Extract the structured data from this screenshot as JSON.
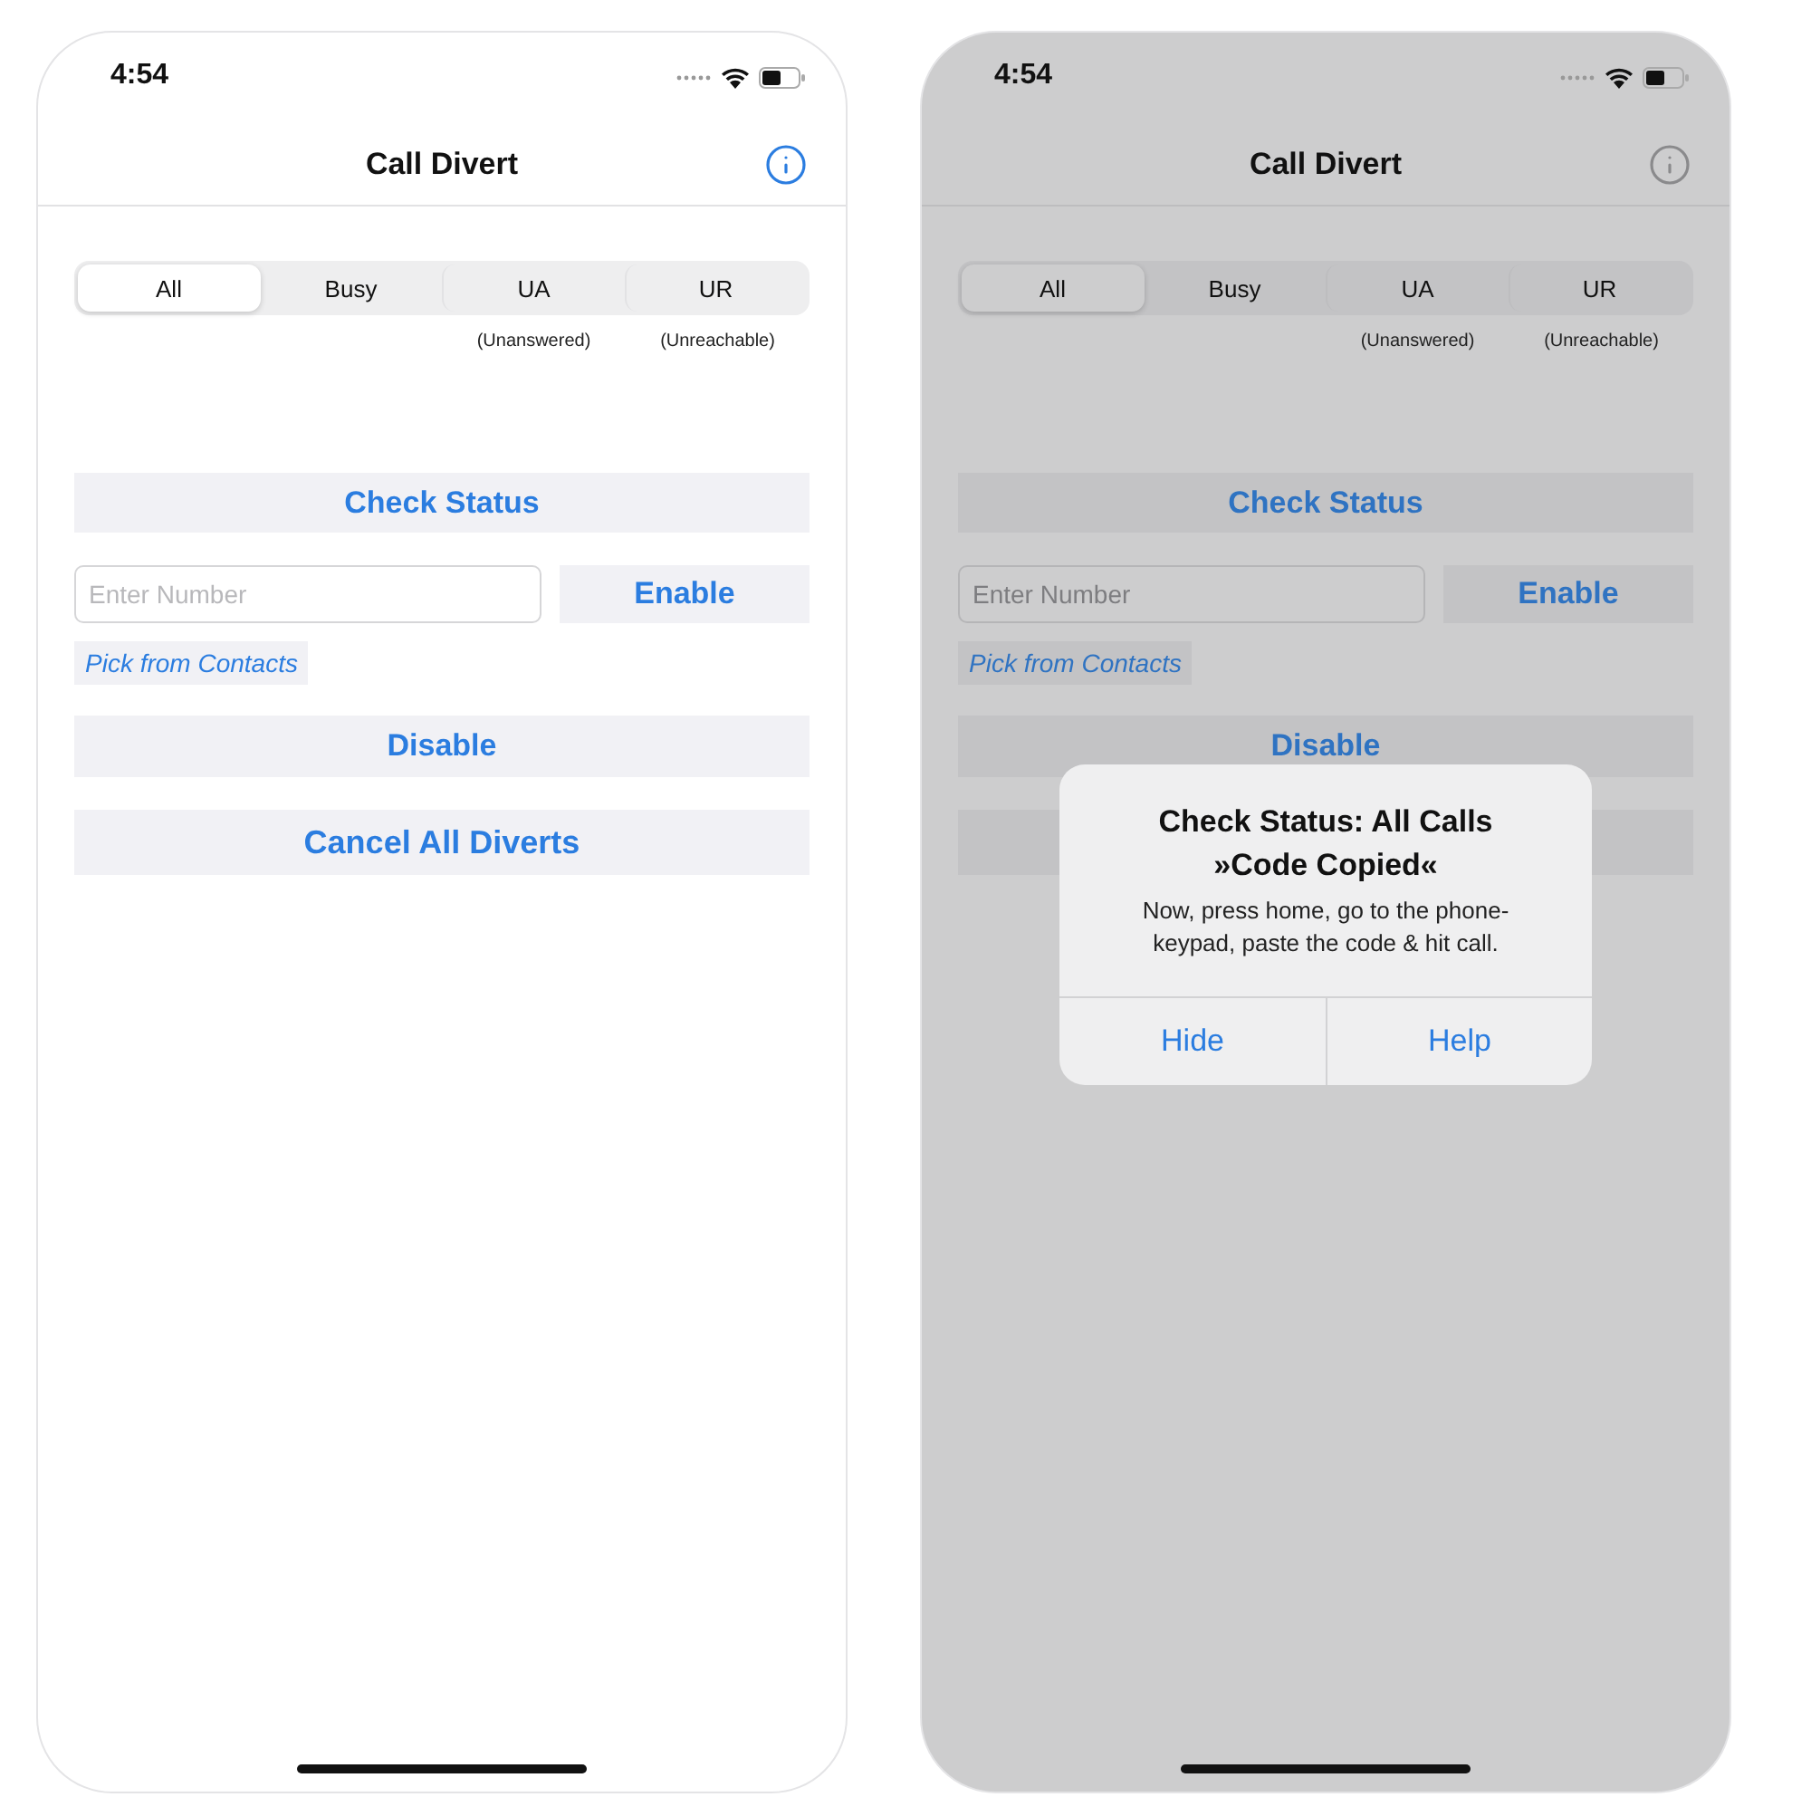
{
  "screens": [
    {
      "dimmed": false,
      "status_bar": {
        "time": "4:54"
      },
      "title": "Call Divert",
      "segments": [
        {
          "label": "All",
          "selected": true
        },
        {
          "label": "Busy",
          "selected": false
        },
        {
          "label": "UA",
          "selected": false,
          "note": "(Unanswered)"
        },
        {
          "label": "UR",
          "selected": false,
          "note": "(Unreachable)"
        }
      ],
      "check_button": "Check Status",
      "number_field": {
        "placeholder": "Enter Number"
      },
      "enable_button": "Enable",
      "contacts_link": "Pick from Contacts",
      "disable_button": "Disable",
      "cancel_button": "Cancel All Diverts"
    },
    {
      "dimmed": true,
      "status_bar": {
        "time": "4:54"
      },
      "title": "Call Divert",
      "segments": [
        {
          "label": "All",
          "selected": true
        },
        {
          "label": "Busy",
          "selected": false
        },
        {
          "label": "UA",
          "selected": false,
          "note": "(Unanswered)"
        },
        {
          "label": "UR",
          "selected": false,
          "note": "(Unreachable)"
        }
      ],
      "check_button": "Check Status",
      "number_field": {
        "placeholder": "Enter Number"
      },
      "enable_button": "Enable",
      "contacts_link": "Pick from Contacts",
      "disable_button": "Disable",
      "alert": {
        "title": "Check Status: All Calls",
        "subtitle": "»Code Copied«",
        "message": "Now, press home, go to the phone-keypad, paste the code & hit call.",
        "buttons": [
          "Hide",
          "Help"
        ]
      }
    }
  ]
}
